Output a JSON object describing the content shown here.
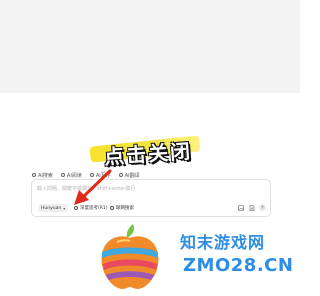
{
  "annotation": {
    "text": "点击关闭"
  },
  "tabs": [
    {
      "label": "AI搜索",
      "icon": "search-icon"
    },
    {
      "label": "AI阅读",
      "icon": "read-icon"
    },
    {
      "label": "AI写作",
      "icon": "write-icon"
    },
    {
      "label": "AI翻译",
      "icon": "translate-icon"
    }
  ],
  "search": {
    "placeholder": "輸入問題、關鍵字或網址，shift+enter換行",
    "model_label": "Hunyuan",
    "deep_think_label": "深度思考(R1)",
    "web_search_label": "联网搜索"
  },
  "watermark": {
    "name": "知末游戏网",
    "url": "ZMO28.CN"
  },
  "colors": {
    "highlight": "#f3e33a",
    "arrow": "#e02a1c",
    "watermark": "#2d8de4"
  }
}
